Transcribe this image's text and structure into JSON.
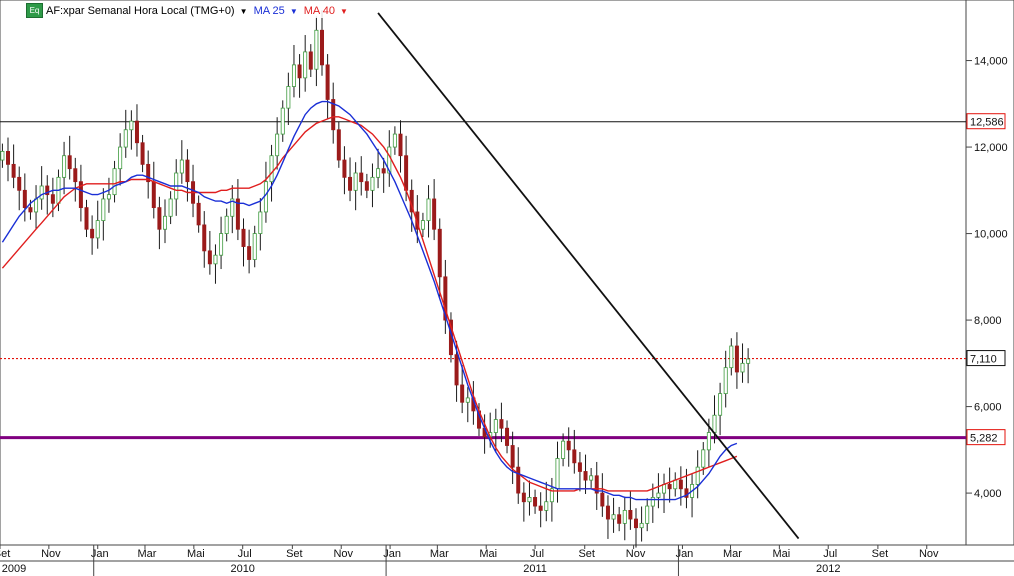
{
  "legend": {
    "badge": "Eq",
    "symbol_text": "AF:xpar Semanal Hora Local (TMG+0)",
    "ma25_label": "MA 25",
    "ma40_label": "MA 40",
    "arrow_glyph": "▼",
    "colors": {
      "ma25": "#1a2fd6",
      "ma40": "#e01e1e",
      "symbol": "#111111"
    }
  },
  "chart_data": {
    "type": "candlestick",
    "title": "AF:xpar Semanal Hora Local (TMG+0)",
    "xlabel": "",
    "ylabel": "",
    "ylim": [
      2800,
      15400
    ],
    "y_ticks": [
      4000,
      6000,
      8000,
      10000,
      12000,
      14000
    ],
    "y_tick_labels": [
      "4,000",
      "6,000",
      "8,000",
      "10,000",
      "12,000",
      "14,000"
    ],
    "grid": false,
    "x_range": [
      "2009-09-01",
      "2012-12-20"
    ],
    "x_month_ticks": [
      {
        "date": "2009-09-01",
        "label": "Set"
      },
      {
        "date": "2009-11-01",
        "label": "Nov"
      },
      {
        "date": "2010-01-01",
        "label": "Jan"
      },
      {
        "date": "2010-03-01",
        "label": "Mar"
      },
      {
        "date": "2010-05-01",
        "label": "Mai"
      },
      {
        "date": "2010-07-01",
        "label": "Jul"
      },
      {
        "date": "2010-09-01",
        "label": "Set"
      },
      {
        "date": "2010-11-01",
        "label": "Nov"
      },
      {
        "date": "2011-01-01",
        "label": "Jan"
      },
      {
        "date": "2011-03-01",
        "label": "Mar"
      },
      {
        "date": "2011-05-01",
        "label": "Mai"
      },
      {
        "date": "2011-07-01",
        "label": "Jul"
      },
      {
        "date": "2011-09-01",
        "label": "Set"
      },
      {
        "date": "2011-11-01",
        "label": "Nov"
      },
      {
        "date": "2012-01-01",
        "label": "Jan"
      },
      {
        "date": "2012-03-01",
        "label": "Mar"
      },
      {
        "date": "2012-05-01",
        "label": "Mai"
      },
      {
        "date": "2012-07-01",
        "label": "Jul"
      },
      {
        "date": "2012-09-01",
        "label": "Set"
      },
      {
        "date": "2012-11-01",
        "label": "Nov"
      }
    ],
    "x_year_labels": [
      {
        "date": "2009-10-15",
        "label": "2009"
      },
      {
        "date": "2010-07-01",
        "label": "2010"
      },
      {
        "date": "2011-07-01",
        "label": "2011"
      },
      {
        "date": "2012-07-01",
        "label": "2012"
      }
    ],
    "x_year_boundaries": [
      "2010-01-01",
      "2011-01-01",
      "2012-01-01"
    ],
    "candle_colors": {
      "up": "#3f9b3f",
      "down": "#9b1b1b",
      "wick": "#1a1a1a"
    },
    "candles_meta": {
      "start": "2009-09-04",
      "step_days": 7
    },
    "closes": [
      11900,
      11600,
      11300,
      11000,
      10600,
      10500,
      10800,
      11100,
      10900,
      10700,
      11300,
      11800,
      11500,
      11200,
      10600,
      10100,
      9900,
      10300,
      10800,
      10900,
      11500,
      12000,
      12400,
      12600,
      12100,
      11600,
      11200,
      10600,
      10100,
      10400,
      10800,
      11400,
      11700,
      11200,
      10700,
      10200,
      9600,
      9300,
      9500,
      10000,
      10400,
      10800,
      10100,
      9700,
      9400,
      10000,
      10500,
      11200,
      11800,
      12300,
      12900,
      13400,
      13900,
      13600,
      14200,
      13800,
      14700,
      13900,
      13100,
      12400,
      11700,
      11300,
      11000,
      11400,
      11200,
      11000,
      11300,
      11500,
      11400,
      12000,
      12300,
      11800,
      11000,
      10500,
      10100,
      10300,
      10800,
      10100,
      9000,
      8000,
      7200,
      6500,
      6100,
      6200,
      5900,
      5500,
      5300,
      5400,
      5700,
      5500,
      5100,
      4600,
      4000,
      3800,
      3900,
      3700,
      3600,
      3800,
      4100,
      4800,
      5200,
      5000,
      4700,
      4500,
      4300,
      4400,
      4000,
      3700,
      3400,
      3500,
      3300,
      3600,
      3400,
      3200,
      3300,
      3700,
      3900,
      4000,
      4200,
      4100,
      4300,
      4100,
      3900,
      4200,
      4600,
      5000,
      5400,
      5800,
      6300,
      6900,
      7400,
      6800,
      7000,
      7100
    ],
    "ma25": [
      9800,
      10000,
      10200,
      10400,
      10550,
      10700,
      10800,
      10900,
      10950,
      11000,
      11000,
      11050,
      11050,
      11050,
      11000,
      10950,
      10900,
      10900,
      10950,
      11000,
      11100,
      11150,
      11200,
      11300,
      11350,
      11350,
      11300,
      11250,
      11200,
      11150,
      11100,
      11100,
      11100,
      11050,
      11000,
      10950,
      10850,
      10800,
      10750,
      10750,
      10700,
      10750,
      10700,
      10700,
      10650,
      10700,
      10750,
      10900,
      11100,
      11350,
      11650,
      11950,
      12250,
      12500,
      12750,
      12900,
      13000,
      13050,
      13050,
      13000,
      12950,
      12850,
      12750,
      12600,
      12450,
      12300,
      12100,
      11900,
      11700,
      11450,
      11200,
      10900,
      10600,
      10300,
      9950,
      9600,
      9250,
      8900,
      8500,
      8100,
      7700,
      7300,
      6900,
      6500,
      6150,
      5800,
      5500,
      5200,
      4950,
      4750,
      4600,
      4500,
      4450,
      4400,
      4350,
      4300,
      4250,
      4200,
      4150,
      4100,
      4100,
      4100,
      4100,
      4100,
      4100,
      4100,
      4050,
      4050,
      4000,
      3950,
      3950,
      3900,
      3900,
      3850,
      3850,
      3850,
      3850,
      3850,
      3850,
      3850,
      3850,
      3900,
      3950,
      4050,
      4150,
      4300,
      4450,
      4650,
      4850,
      5000,
      5100,
      5150
    ],
    "ma40": [
      9200,
      9350,
      9500,
      9650,
      9800,
      9950,
      10100,
      10250,
      10400,
      10550,
      10700,
      10850,
      10950,
      11050,
      11100,
      11150,
      11150,
      11150,
      11150,
      11150,
      11150,
      11200,
      11200,
      11250,
      11250,
      11250,
      11250,
      11200,
      11150,
      11100,
      11050,
      11000,
      11000,
      10950,
      10950,
      10950,
      10950,
      10950,
      10950,
      11000,
      11000,
      11050,
      11050,
      11050,
      11050,
      11100,
      11150,
      11250,
      11400,
      11550,
      11750,
      11900,
      12050,
      12200,
      12350,
      12450,
      12550,
      12600,
      12650,
      12700,
      12700,
      12650,
      12600,
      12550,
      12500,
      12400,
      12300,
      12150,
      12000,
      11800,
      11550,
      11300,
      11000,
      10650,
      10250,
      9850,
      9450,
      9050,
      8650,
      8250,
      7850,
      7450,
      7050,
      6650,
      6250,
      5900,
      5600,
      5300,
      5050,
      4850,
      4700,
      4550,
      4450,
      4350,
      4250,
      4200,
      4150,
      4100,
      4050,
      4050,
      4050,
      4050,
      4050,
      4100,
      4100,
      4100,
      4100,
      4100,
      4050,
      4050,
      4050,
      4050,
      4050,
      4050,
      4050,
      4050,
      4100,
      4150,
      4200,
      4250,
      4300,
      4350,
      4400,
      4450,
      4500,
      4550,
      4600,
      4650,
      4700,
      4750,
      4800,
      4850
    ],
    "horizontal_lines": [
      {
        "value": 12586,
        "label": "12,586",
        "style": "solid",
        "color": "#111111",
        "box_color": "#e3120b"
      },
      {
        "value": 7110,
        "label": "7,110",
        "style": "dotted",
        "color": "#e3120b",
        "box_color": "#111111"
      },
      {
        "value": 5282,
        "label": "5,282",
        "style": "thick",
        "color": "#800080",
        "box_color": "#e3120b"
      }
    ],
    "trendline": {
      "start": {
        "date": "2010-12-17",
        "value": 15100
      },
      "end": {
        "date": "2012-05-25",
        "value": 2950
      },
      "color": "#111111"
    }
  }
}
